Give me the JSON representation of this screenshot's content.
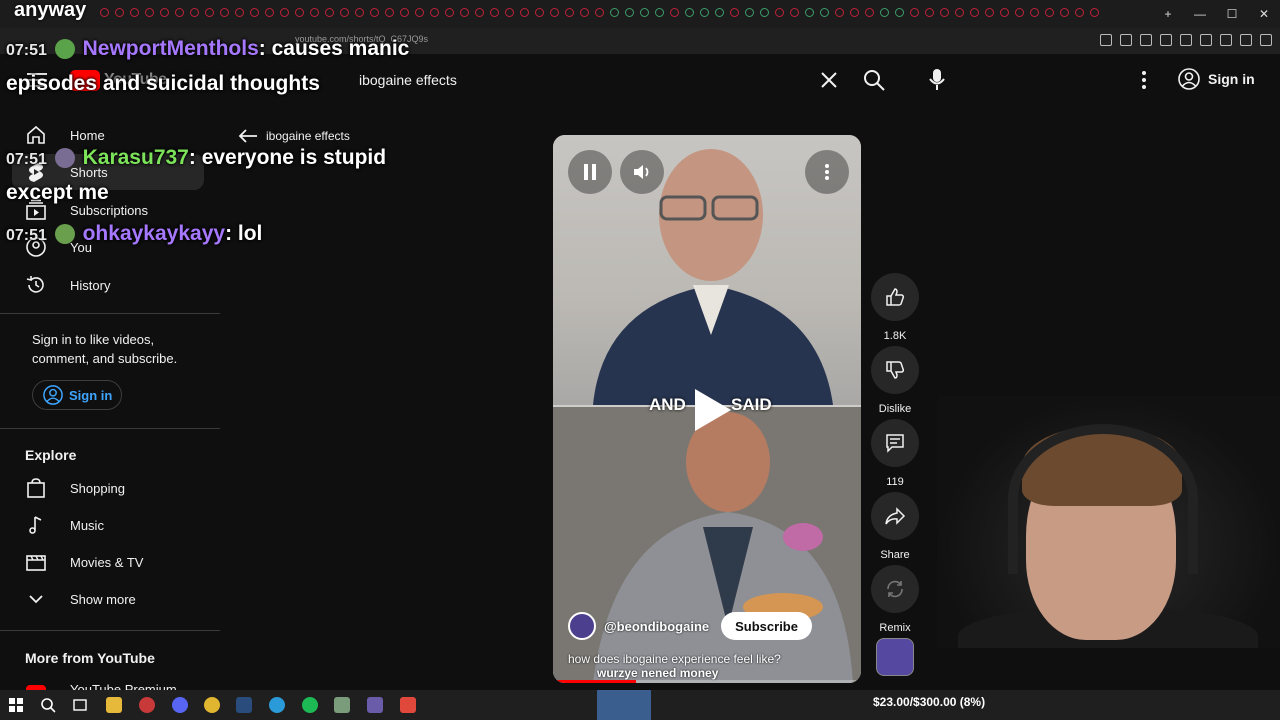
{
  "browser": {
    "url": "youtube.com/shorts/tQ_C67JQ9s",
    "window_controls": [
      "—",
      "☐",
      "✕"
    ],
    "new_tab": "+"
  },
  "header": {
    "logo_text": "YouTube",
    "search_value": "ibogaine effects",
    "sign_in": "Sign in"
  },
  "sidebar": {
    "items": [
      {
        "label": "Home",
        "icon": "home-icon"
      },
      {
        "label": "Shorts",
        "icon": "shorts-icon"
      },
      {
        "label": "Subscriptions",
        "icon": "subscriptions-icon"
      },
      {
        "label": "You",
        "icon": "you-icon"
      },
      {
        "label": "History",
        "icon": "history-icon"
      }
    ],
    "signin_message": "Sign in to like videos, comment, and subscribe.",
    "signin_button": "Sign in",
    "explore_title": "Explore",
    "explore_items": [
      {
        "label": "Shopping",
        "icon": "shopping-icon"
      },
      {
        "label": "Music",
        "icon": "music-icon"
      },
      {
        "label": "Movies & TV",
        "icon": "movies-icon"
      },
      {
        "label": "Show more",
        "icon": "chevron-down-icon"
      }
    ],
    "more_title": "More from YouTube",
    "more_items": [
      {
        "label": "YouTube Premium"
      }
    ]
  },
  "back_link": "ibogaine effects",
  "chat": {
    "top_word": "anyway",
    "messages": [
      {
        "time": "07:51",
        "user": "NewportMenthols",
        "user_color": "#a678ff",
        "text": "causes manic episodes and suicidal thoughts"
      },
      {
        "time": "07:51",
        "user": "Karasu737",
        "user_color": "#7de35a",
        "text": "everyone is stupid except me"
      },
      {
        "time": "07:51",
        "user": "ohkaykaykayy",
        "user_color": "#a678ff",
        "text": "lol"
      }
    ]
  },
  "video": {
    "caption_left": "AND",
    "caption_right": "SAID",
    "channel": "@beondibogaine",
    "subscribe": "Subscribe",
    "title": "how does ibogaine experience feel like?",
    "subtitle": "wurzye nened money",
    "progress_percent": 27
  },
  "actions": {
    "likes": "1.8K",
    "dislike": "Dislike",
    "comments": "119",
    "share": "Share",
    "remix": "Remix"
  },
  "overlay": {
    "donation": "$23.00/$300.00 (8%)"
  },
  "colors": {
    "background": "#0f0f0f",
    "accent_blue": "#3ea6ff",
    "youtube_red": "#ff0000"
  }
}
